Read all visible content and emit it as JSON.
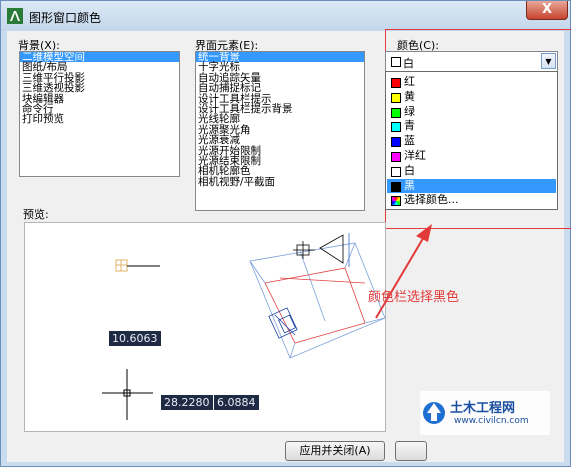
{
  "window": {
    "title": "图形窗口颜色",
    "close_label": "X"
  },
  "background": {
    "label": "背景(X):",
    "items": [
      "二维模型空间",
      "图纸/布局",
      "三维平行投影",
      "三维透视投影",
      "块编辑器",
      "命令行",
      "打印预览"
    ],
    "selected": 0
  },
  "elements": {
    "label": "界面元素(E):",
    "items": [
      "统一背景",
      "十字光标",
      "自动追踪矢量",
      "自动捕捉标记",
      "设计工具栏提示",
      "设计工具栏提示背景",
      "光线轮廓",
      "光源聚光角",
      "光源衰减",
      "光源开始限制",
      "光源结束限制",
      "相机轮廓色",
      "相机视野/平截面"
    ],
    "selected": 0
  },
  "color": {
    "label": "颜色(C):",
    "current": "白",
    "options": [
      {
        "name": "红",
        "swatch": "#ff0000"
      },
      {
        "name": "黄",
        "swatch": "#ffff00"
      },
      {
        "name": "绿",
        "swatch": "#00ff00"
      },
      {
        "name": "青",
        "swatch": "#00ffff"
      },
      {
        "name": "蓝",
        "swatch": "#0000ff"
      },
      {
        "name": "洋红",
        "swatch": "#ff00ff"
      },
      {
        "name": "白",
        "swatch": "#ffffff"
      },
      {
        "name": "黑",
        "swatch": "#000000"
      },
      {
        "name": "选择颜色...",
        "swatch": "multicolor"
      }
    ],
    "highlighted": 7
  },
  "preview": {
    "label": "预览:",
    "dims": [
      "10.6063",
      "28.2280",
      "6.0884"
    ]
  },
  "buttons": {
    "apply_close": "应用并关闭(A)"
  },
  "annotation": "颜色栏选择黑色",
  "watermark": {
    "brand": "土木工程网",
    "url": "www.civilcn.com"
  },
  "colors": {
    "annotation_red": "#e23a3a",
    "selection_blue": "#3399ff"
  }
}
